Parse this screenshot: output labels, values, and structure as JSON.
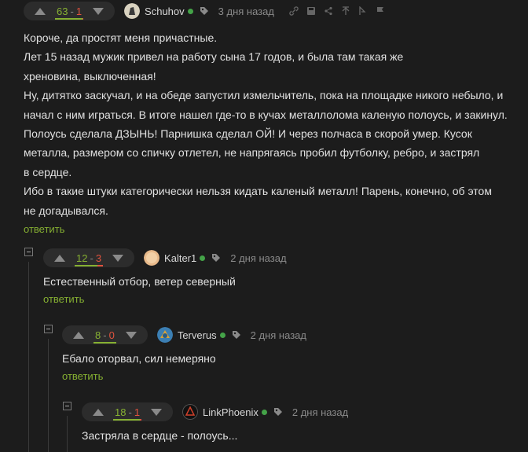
{
  "comments": [
    {
      "score": {
        "plus": "63",
        "minus": "1",
        "ratio": 0.98
      },
      "user": "Schuhov",
      "time": "3 дня назад",
      "avatar_color": "#d9d2c0",
      "lines": [
        "Короче, да простят меня причастные.",
        "Лет 15 назад мужик привел на работу сына 17 годов, и была там такая же",
        "хреновина, выключенная!",
        "Ну, дитятко заскучал, и на обеде запустил измельчитель, пока на площадке никого небыло, и",
        "начал с ним играться. В итоге нашел где-то в кучах металлолома каленую полоусь, и закинул.",
        "Полоусь сделала ДЗЫНЬ! Парнишка сделал ОЙ! И через полчаса в скорой умер. Кусок",
        "металла, размером со спичку отлетел, не напрягаясь пробил футболку, ребро, и застрял",
        "в сердце.",
        "Ибо в такие штуки категорически нельзя кидать каленый металл! Парень, конечно, об этом",
        "не догадывался."
      ],
      "reply": "ответить",
      "action_icons": [
        "link-icon",
        "save-icon",
        "share-icon",
        "upvote-outline-icon",
        "hide-icon",
        "flag-icon"
      ]
    },
    {
      "score": {
        "plus": "12",
        "minus": "3",
        "ratio": 0.8
      },
      "user": "Kalter1",
      "time": "2 дня назад",
      "avatar_color": "#e8b98a",
      "lines": [
        "Естественный отбор, ветер северный"
      ],
      "reply": "ответить"
    },
    {
      "score": {
        "plus": "8",
        "minus": "0",
        "ratio": 1
      },
      "user": "Terverus",
      "time": "2 дня назад",
      "avatar_color": "#3c7fb3",
      "lines": [
        "Ебало оторвал, сил немеряно"
      ],
      "reply": "ответить"
    },
    {
      "score": {
        "plus": "18",
        "minus": "1",
        "ratio": 0.95
      },
      "user": "LinkPhoenix",
      "time": "2 дня назад",
      "avatar_color": "#1a1a1a",
      "lines": [
        "Застряла в сердце - полоусь..."
      ]
    }
  ],
  "colors": {
    "background": "#1c1c1c",
    "plus": "#86b032",
    "minus": "#e0523e",
    "online": "#44a348"
  }
}
